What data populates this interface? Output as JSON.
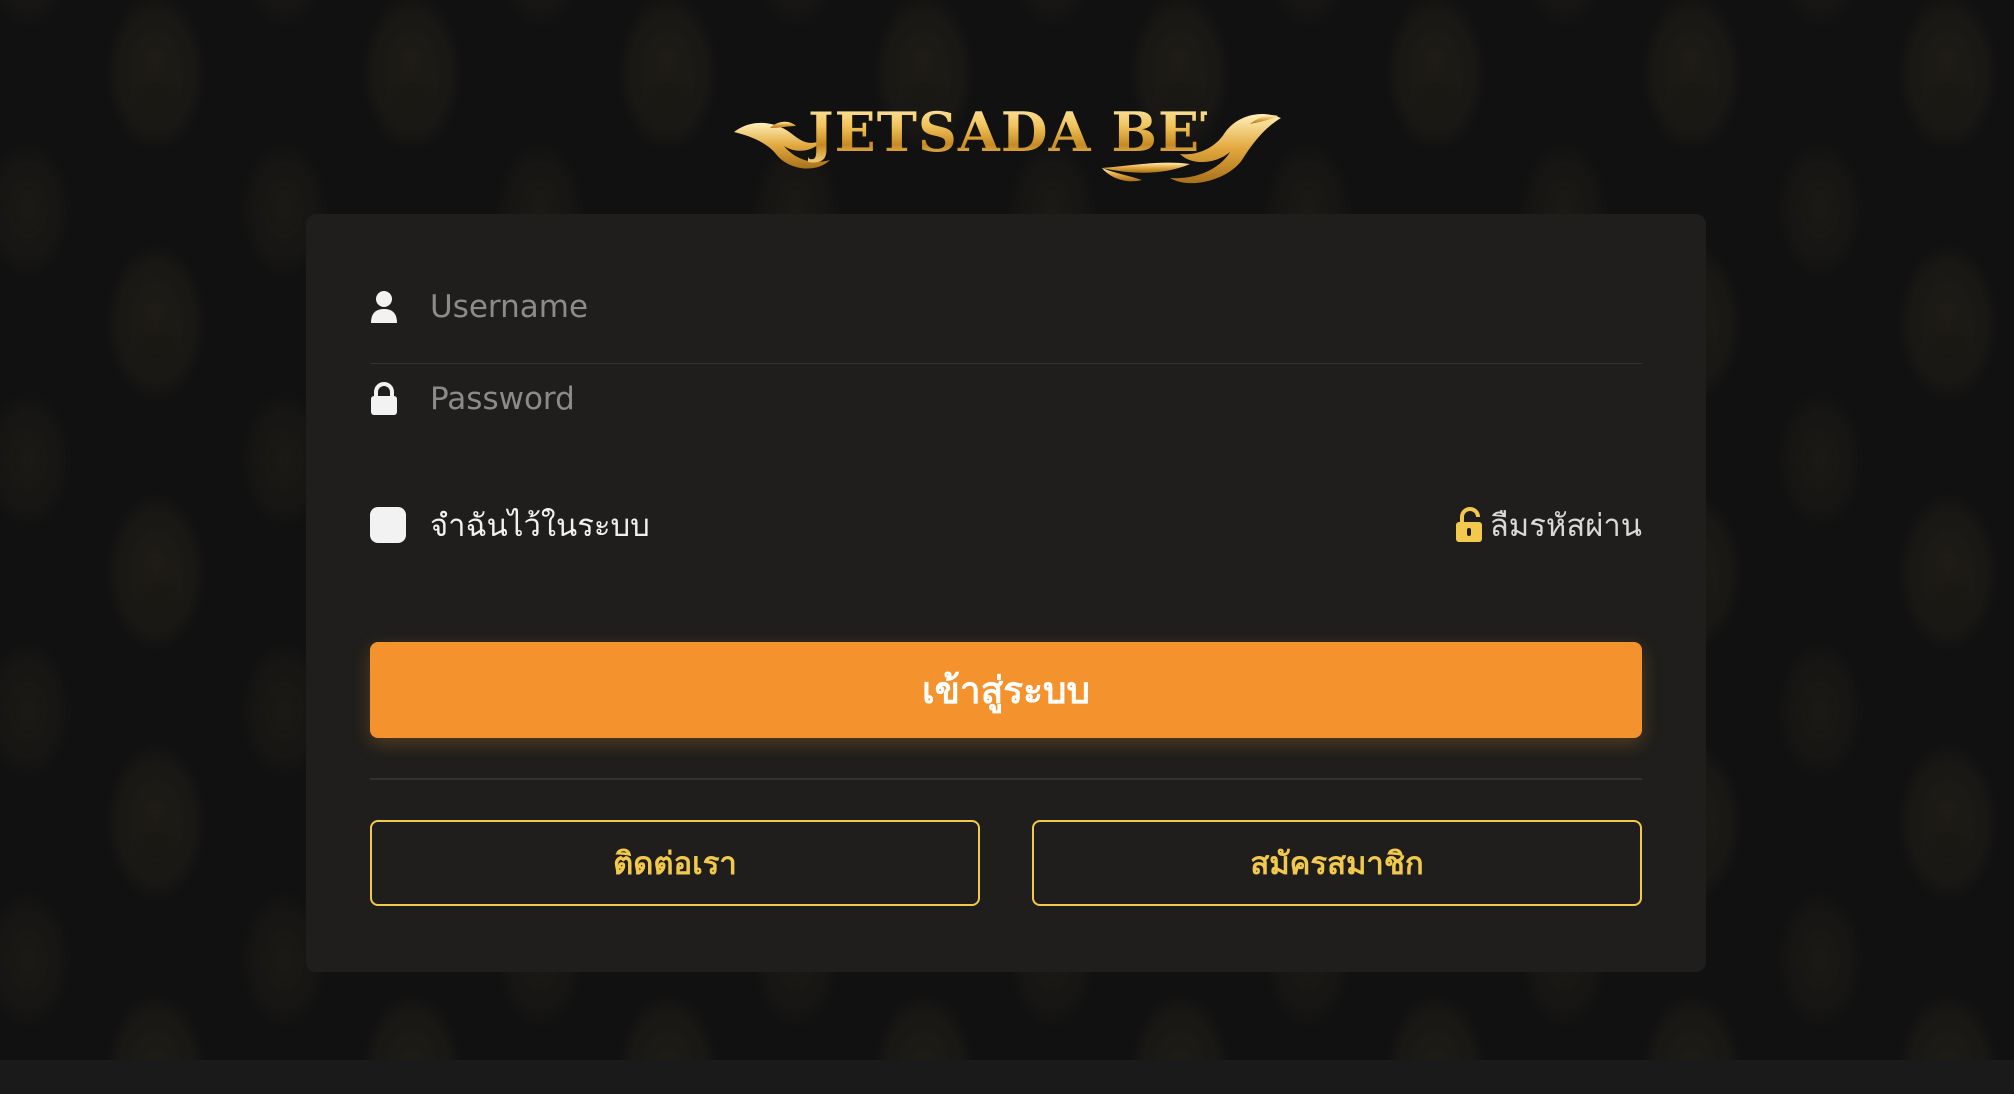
{
  "logo": {
    "text": "JETSADA BET",
    "color": "#e7b54f"
  },
  "form": {
    "username": {
      "placeholder": "Username",
      "value": "",
      "icon": "user-icon"
    },
    "password": {
      "placeholder": "Password",
      "value": "",
      "icon": "lock-icon"
    },
    "remember_label": "จำฉันไว้ในระบบ",
    "remember_checked": false,
    "forgot_label": "ลืมรหัสผ่าน",
    "forgot_icon": "unlock-icon",
    "login_label": "เข้าสู่ระบบ",
    "contact_label": "ติดต่อเรา",
    "register_label": "สมัครสมาชิก"
  },
  "colors": {
    "background": "#111111",
    "card": "#1f1e1c",
    "accent_orange": "#f4922e",
    "accent_gold": "#f2c94c"
  }
}
